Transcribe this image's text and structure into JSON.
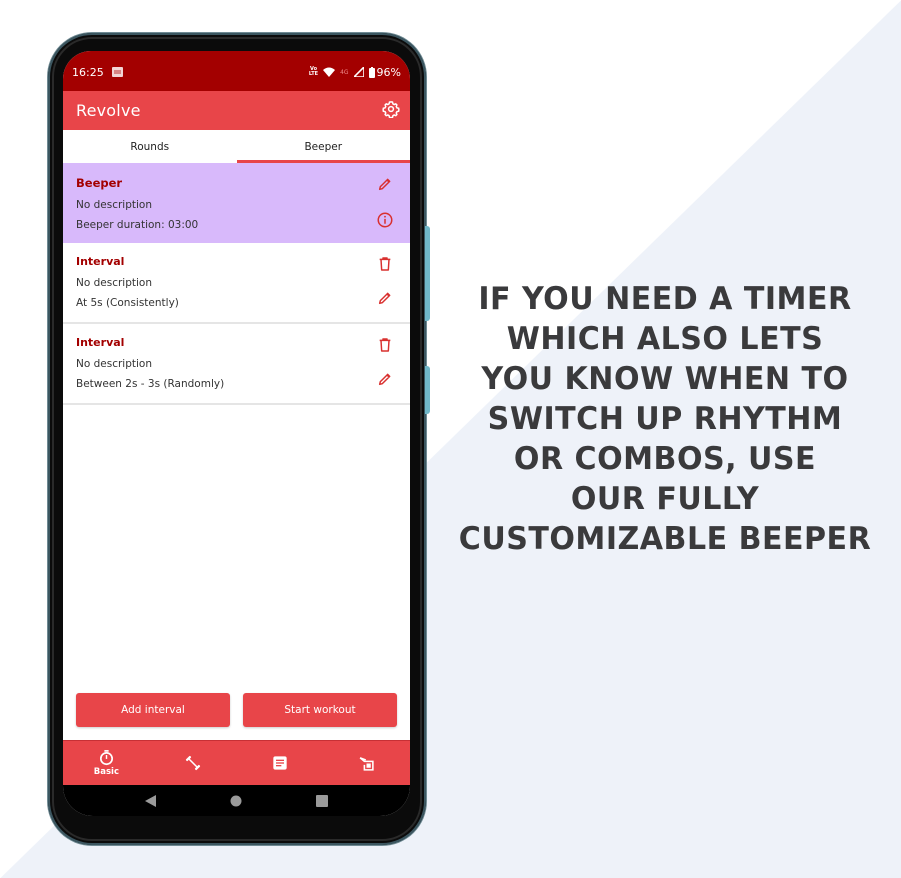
{
  "status_bar": {
    "time": "16:25",
    "network_top": "VoLTE",
    "network_label": "4G",
    "battery": "96%"
  },
  "app": {
    "title": "Revolve",
    "settings_icon": "gear-icon"
  },
  "tabs": [
    {
      "label": "Rounds",
      "active": false
    },
    {
      "label": "Beeper",
      "active": true
    }
  ],
  "beeper": {
    "title": "Beeper",
    "description": "No description",
    "duration": "Beeper duration: 03:00",
    "icons": [
      "pencil-icon",
      "info-icon"
    ],
    "highlight_color": "#d8b9fb"
  },
  "intervals": [
    {
      "title": "Interval",
      "description": "No description",
      "detail": "At 5s (Consistently)"
    },
    {
      "title": "Interval",
      "description": "No description",
      "detail": "Between 2s - 3s (Randomly)"
    }
  ],
  "actions": {
    "add_interval": "Add interval",
    "start_workout": "Start workout"
  },
  "bottom_nav": [
    {
      "icon": "stopwatch-icon",
      "label": "Basic"
    },
    {
      "icon": "dumbbell-icon",
      "label": ""
    },
    {
      "icon": "notes-icon",
      "label": ""
    },
    {
      "icon": "exercise-icon",
      "label": ""
    }
  ],
  "colors": {
    "primary": "#e84549",
    "status_bar": "#a30000",
    "title_text": "#a30000"
  },
  "tagline": [
    "IF YOU NEED A TIMER",
    "WHICH ALSO LETS",
    "YOU KNOW WHEN TO",
    "SWITCH UP RHYTHM",
    "OR COMBOS, USE",
    "OUR FULLY",
    "CUSTOMIZABLE BEEPER"
  ]
}
